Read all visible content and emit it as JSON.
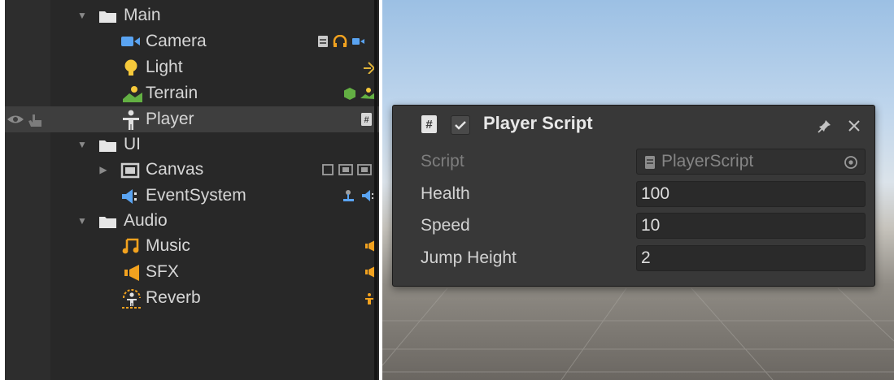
{
  "hierarchy": {
    "items": [
      {
        "label": "Main",
        "icon": "folder-icon",
        "expanded": true
      },
      {
        "label": "Camera",
        "icon": "camera-icon",
        "components": [
          "script-icon",
          "audio-listener-icon",
          "camera-icon"
        ]
      },
      {
        "label": "Light",
        "icon": "light-bulb-icon",
        "components": [
          "light-icon"
        ]
      },
      {
        "label": "Terrain",
        "icon": "terrain-icon",
        "components": [
          "cube-icon",
          "terrain-icon"
        ]
      },
      {
        "label": "Player",
        "icon": "player-icon",
        "components": [
          "script-icon"
        ],
        "selected": true
      },
      {
        "label": "UI",
        "icon": "folder-icon",
        "expanded": true
      },
      {
        "label": "Canvas",
        "icon": "canvas-icon",
        "collapsed": true,
        "components": [
          "rect-transform-icon",
          "canvas-icon",
          "canvas-icon"
        ]
      },
      {
        "label": "EventSystem",
        "icon": "event-system-icon",
        "components": [
          "event-trigger-icon",
          "event-system-icon"
        ]
      },
      {
        "label": "Audio",
        "icon": "folder-icon",
        "expanded": true
      },
      {
        "label": "Music",
        "icon": "music-note-icon",
        "components": [
          "audio-source-icon"
        ]
      },
      {
        "label": "SFX",
        "icon": "speaker-icon",
        "components": [
          "audio-source-icon"
        ]
      },
      {
        "label": "Reverb",
        "icon": "reverb-zone-icon",
        "components": [
          "reverb-zone-icon"
        ]
      }
    ]
  },
  "inspector": {
    "title": "Player Script",
    "enabled": true,
    "fields": [
      {
        "label": "Script",
        "value": "PlayerScript",
        "disabled": true
      },
      {
        "label": "Health",
        "value": "100"
      },
      {
        "label": "Speed",
        "value": "10"
      },
      {
        "label": "Jump Height",
        "value": "2"
      }
    ]
  },
  "colors": {
    "panel_bg": "#282828",
    "selected_row": "#3e3e3e",
    "camera_blue": "#5aa4f2",
    "light_yellow": "#f6c93b",
    "audio_orange": "#f2a21f",
    "terrain_green": "#63b043",
    "popup_bg": "#383838"
  }
}
